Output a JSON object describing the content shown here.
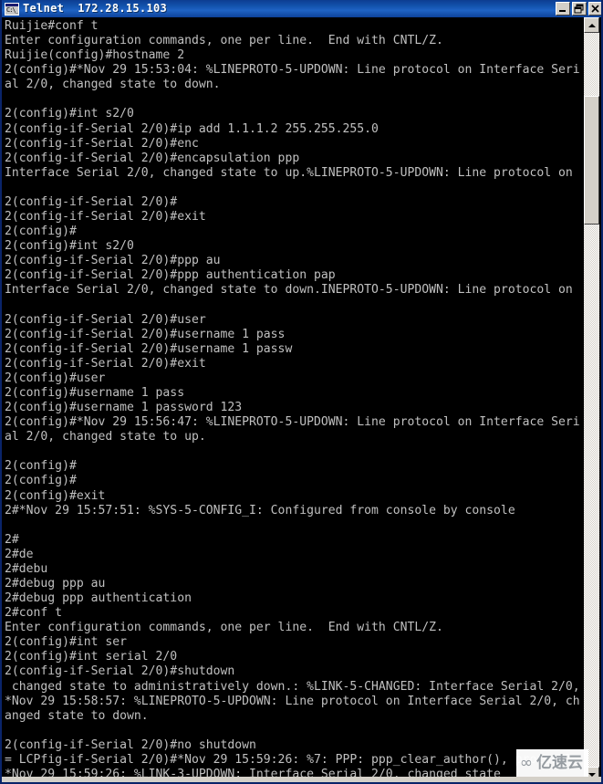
{
  "window": {
    "title": "Telnet  172.28.15.103",
    "icon": "telnet-icon",
    "buttons": {
      "minimize": "minimize-button",
      "restore": "restore-button",
      "close": "close-button"
    },
    "colors": {
      "titlebar": "#0d4299",
      "chrome": "#d4d0c8",
      "terminal_bg": "#000000",
      "terminal_fg": "#c0c0c0"
    }
  },
  "scrollbar": {
    "up_arrow": "scroll-up-arrow",
    "down_arrow": "scroll-down-arrow",
    "thumb": "scrollbar-thumb"
  },
  "watermark": {
    "mark": "∞",
    "text": "亿速云"
  },
  "terminal": {
    "lines": [
      "Ruijie#conf t",
      "Enter configuration commands, one per line.  End with CNTL/Z.",
      "Ruijie(config)#hostname 2",
      "2(config)#*Nov 29 15:53:04: %LINEPROTO-5-UPDOWN: Line protocol on Interface Seri",
      "al 2/0, changed state to down.",
      "",
      "2(config)#int s2/0",
      "2(config-if-Serial 2/0)#ip add 1.1.1.2 255.255.255.0",
      "2(config-if-Serial 2/0)#enc",
      "2(config-if-Serial 2/0)#encapsulation ppp",
      "Interface Serial 2/0, changed state to up.%LINEPROTO-5-UPDOWN: Line protocol on",
      "",
      "2(config-if-Serial 2/0)#",
      "2(config-if-Serial 2/0)#exit",
      "2(config)#",
      "2(config)#int s2/0",
      "2(config-if-Serial 2/0)#ppp au",
      "2(config-if-Serial 2/0)#ppp authentication pap",
      "Interface Serial 2/0, changed state to down.INEPROTO-5-UPDOWN: Line protocol on",
      "",
      "2(config-if-Serial 2/0)#user",
      "2(config-if-Serial 2/0)#username 1 pass",
      "2(config-if-Serial 2/0)#username 1 passw",
      "2(config-if-Serial 2/0)#exit",
      "2(config)#user",
      "2(config)#username 1 pass",
      "2(config)#username 1 password 123",
      "2(config)#*Nov 29 15:56:47: %LINEPROTO-5-UPDOWN: Line protocol on Interface Seri",
      "al 2/0, changed state to up.",
      "",
      "2(config)#",
      "2(config)#",
      "2(config)#exit",
      "2#*Nov 29 15:57:51: %SYS-5-CONFIG_I: Configured from console by console",
      "",
      "2#",
      "2#de",
      "2#debu",
      "2#debug ppp au",
      "2#debug ppp authentication",
      "2#conf t",
      "Enter configuration commands, one per line.  End with CNTL/Z.",
      "2(config)#int ser",
      "2(config)#int serial 2/0",
      "2(config-if-Serial 2/0)#shutdown",
      " changed state to administratively down.: %LINK-5-CHANGED: Interface Serial 2/0,",
      "*Nov 29 15:58:57: %LINEPROTO-5-UPDOWN: Line protocol on Interface Serial 2/0, ch",
      "anged state to down.",
      "",
      "2(config-if-Serial 2/0)#no shutdown",
      "= LCPfig-if-Serial 2/0)#*Nov 29 15:59:26: %7: PPP: ppp_clear_author(), protocol",
      "*Nov 29 15:59:26: %LINK-3-UPDOWN: Interface Serial 2/0, changed state"
    ]
  }
}
